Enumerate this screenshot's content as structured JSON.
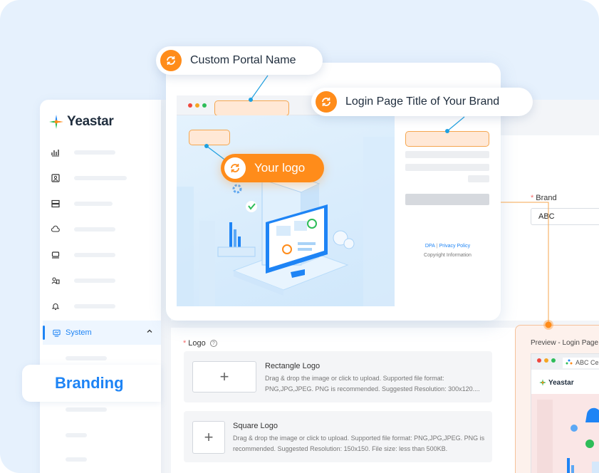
{
  "sidebar": {
    "brand_name": "Yeastar",
    "active_item_label": "System",
    "nav_icons": [
      "dashboard-icon",
      "contacts-icon",
      "storage-icon",
      "cloud-icon",
      "printer-icon",
      "users-icon",
      "bell-icon"
    ]
  },
  "branding_label": "Branding",
  "callouts": {
    "portal_name": "Custom Portal Name",
    "login_title": "Login Page Title of Your Brand",
    "your_logo": "Your logo"
  },
  "login_preview": {
    "dpa_link": "DPA",
    "privacy_link": "Privacy Policy",
    "separator": "|",
    "copyright": "Copyright Information"
  },
  "brand_field": {
    "label": "Brand",
    "required_mark": "*",
    "value": "ABC"
  },
  "logo_field": {
    "label": "Logo",
    "required_mark": "*",
    "help_icon": "?",
    "rectangle": {
      "title": "Rectangle Logo",
      "description": "Drag & drop the image or click to upload. Supported file format: PNG,JPG,JPEG. PNG is recommended. Suggested Resolution: 300x120....",
      "plus": "+"
    },
    "square": {
      "title": "Square Logo",
      "description": "Drag & drop the image or click to upload. Supported file format: PNG,JPG,JPEG. PNG is recommended. Suggested Resolution: 150x150. File size: less than 500KB.",
      "plus": "+"
    }
  },
  "preview": {
    "title": "Preview - Login Page",
    "tab_label": "ABC Ce",
    "brand_name": "Yeastar"
  },
  "colors": {
    "accent_blue": "#1e84f5",
    "accent_orange": "#ff8c1a",
    "background": "#e6f1fd"
  }
}
